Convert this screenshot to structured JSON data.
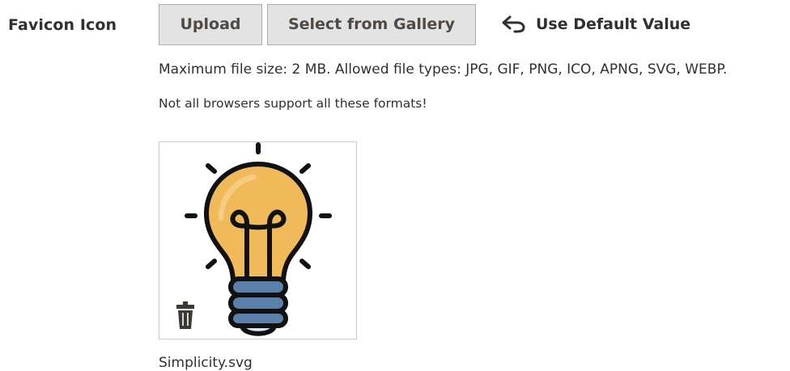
{
  "field": {
    "label": "Favicon Icon"
  },
  "buttons": {
    "upload_label": "Upload",
    "gallery_label": "Select from Gallery"
  },
  "default_value": {
    "label": "Use Default Value",
    "icon": "undo-arrow-icon"
  },
  "notes": {
    "file_limits": "Maximum file size: 2 MB. Allowed file types: JPG, GIF, PNG, ICO, APNG, SVG, WEBP.",
    "browser_support": "Not all browsers support all these formats!"
  },
  "preview": {
    "image_icon": "lightbulb-icon",
    "delete_icon": "trash-icon",
    "filename": "Simplicity.svg"
  },
  "colors": {
    "button_bg": "#e3e3e3",
    "button_border": "#adadad",
    "text": "#303030",
    "bulb_fill": "#f0b95a",
    "bulb_base": "#5a7fa8",
    "trash": "#3d3a36"
  }
}
